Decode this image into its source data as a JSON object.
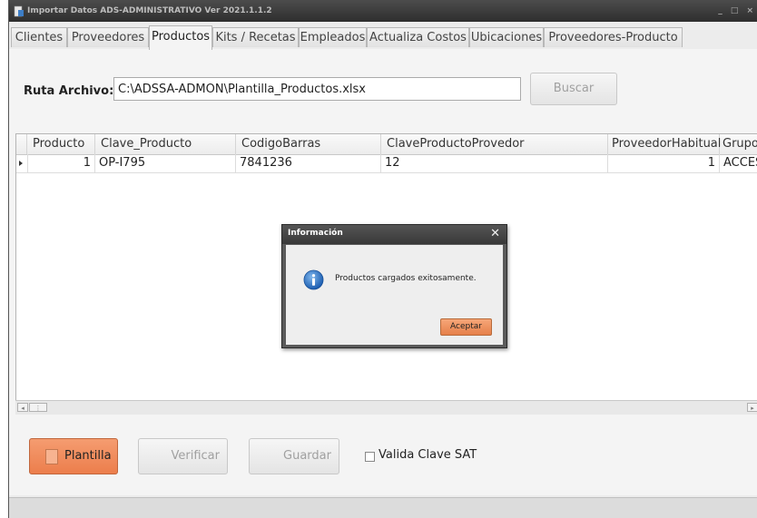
{
  "window": {
    "title": "Importar Datos ADS-ADMINISTRATIVO Ver 2021.1.1.2",
    "controls": "_ □ ×"
  },
  "tabs": [
    {
      "label": "Clientes",
      "active": false
    },
    {
      "label": "Proveedores",
      "active": false
    },
    {
      "label": "Productos",
      "active": true
    },
    {
      "label": "Kits / Recetas",
      "active": false
    },
    {
      "label": "Empleados",
      "active": false
    },
    {
      "label": "Actualiza Costos",
      "active": false
    },
    {
      "label": "Ubicaciones",
      "active": false
    },
    {
      "label": "Proveedores-Producto",
      "active": false
    }
  ],
  "file": {
    "label": "Ruta Archivo:",
    "path": "C:\\ADSSA-ADMON\\Plantilla_Productos.xlsx",
    "browse_label": "Buscar"
  },
  "grid": {
    "columns": [
      "Producto",
      "Clave_Producto",
      "CodigoBarras",
      "ClaveProductoProvedor",
      "ProveedorHabitual",
      "Grupo"
    ],
    "rows": [
      [
        "1",
        "OP-I795",
        "7841236",
        "12",
        "1",
        "ACCES"
      ]
    ]
  },
  "actions": {
    "plantilla": "Plantilla",
    "verificar": "Verificar",
    "guardar": "Guardar",
    "valida_sat": "Valida Clave SAT",
    "valida_sat_checked": false
  },
  "dialog": {
    "title": "Información",
    "message": "Productos cargados exitosamente.",
    "ok_label": "Aceptar",
    "close_glyph": "✕"
  },
  "colors": {
    "accent_orange": "#f28a5a",
    "titlebar_dark": "#3a3a3a",
    "info_blue": "#1a63b8"
  }
}
